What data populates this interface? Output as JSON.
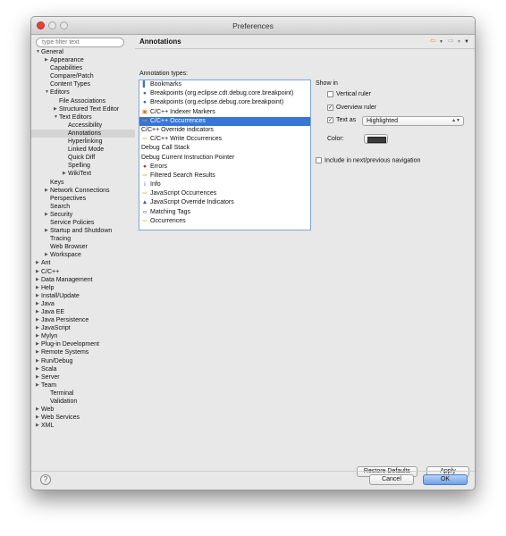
{
  "window": {
    "title": "Preferences"
  },
  "filter": {
    "placeholder": "type filter text"
  },
  "tree": [
    {
      "label": "General",
      "level": 0,
      "tw": "down"
    },
    {
      "label": "Appearance",
      "level": 1,
      "tw": "right"
    },
    {
      "label": "Capabilities",
      "level": 1
    },
    {
      "label": "Compare/Patch",
      "level": 1
    },
    {
      "label": "Content Types",
      "level": 1
    },
    {
      "label": "Editors",
      "level": 1,
      "tw": "down"
    },
    {
      "label": "File Associations",
      "level": 2
    },
    {
      "label": "Structured Text Editor",
      "level": 2,
      "tw": "right"
    },
    {
      "label": "Text Editors",
      "level": 2,
      "tw": "down"
    },
    {
      "label": "Accessibility",
      "level": 3
    },
    {
      "label": "Annotations",
      "level": 3,
      "selected": true
    },
    {
      "label": "Hyperlinking",
      "level": 3
    },
    {
      "label": "Linked Mode",
      "level": 3
    },
    {
      "label": "Quick Diff",
      "level": 3
    },
    {
      "label": "Spelling",
      "level": 3
    },
    {
      "label": "WikiText",
      "level": 3,
      "tw": "right"
    },
    {
      "label": "Keys",
      "level": 1
    },
    {
      "label": "Network Connections",
      "level": 1,
      "tw": "right"
    },
    {
      "label": "Perspectives",
      "level": 1
    },
    {
      "label": "Search",
      "level": 1
    },
    {
      "label": "Security",
      "level": 1,
      "tw": "right"
    },
    {
      "label": "Service Policies",
      "level": 1
    },
    {
      "label": "Startup and Shutdown",
      "level": 1,
      "tw": "right"
    },
    {
      "label": "Tracing",
      "level": 1
    },
    {
      "label": "Web Browser",
      "level": 1
    },
    {
      "label": "Workspace",
      "level": 1,
      "tw": "right"
    },
    {
      "label": "Ant",
      "level": 0,
      "tw": "right"
    },
    {
      "label": "C/C++",
      "level": 0,
      "tw": "right"
    },
    {
      "label": "Data Management",
      "level": 0,
      "tw": "right"
    },
    {
      "label": "Help",
      "level": 0,
      "tw": "right"
    },
    {
      "label": "Install/Update",
      "level": 0,
      "tw": "right"
    },
    {
      "label": "Java",
      "level": 0,
      "tw": "right"
    },
    {
      "label": "Java EE",
      "level": 0,
      "tw": "right"
    },
    {
      "label": "Java Persistence",
      "level": 0,
      "tw": "right"
    },
    {
      "label": "JavaScript",
      "level": 0,
      "tw": "right"
    },
    {
      "label": "Mylyn",
      "level": 0,
      "tw": "right"
    },
    {
      "label": "Plug-in Development",
      "level": 0,
      "tw": "right"
    },
    {
      "label": "Remote Systems",
      "level": 0,
      "tw": "right"
    },
    {
      "label": "Run/Debug",
      "level": 0,
      "tw": "right"
    },
    {
      "label": "Scala",
      "level": 0,
      "tw": "right"
    },
    {
      "label": "Server",
      "level": 0,
      "tw": "right"
    },
    {
      "label": "Team",
      "level": 0,
      "tw": "right"
    },
    {
      "label": "Terminal",
      "level": 1
    },
    {
      "label": "Validation",
      "level": 1
    },
    {
      "label": "Web",
      "level": 0,
      "tw": "right"
    },
    {
      "label": "Web Services",
      "level": 0,
      "tw": "right"
    },
    {
      "label": "XML",
      "level": 0,
      "tw": "right"
    }
  ],
  "page": {
    "title": "Annotations",
    "annotation_types_label": "Annotation types:",
    "annotation_types": [
      {
        "label": "Bookmarks",
        "icon": "bookmark-icon",
        "glyph": "▌",
        "color": "#3a6fc9"
      },
      {
        "label": "Breakpoints (org.eclipse.cdt.debug.core.breakpoint)",
        "icon": "breakpoint-icon",
        "glyph": "●",
        "color": "#3b6bb0"
      },
      {
        "label": "Breakpoints (org.eclipse.debug.core.breakpoint)",
        "icon": "breakpoint-icon",
        "glyph": "●",
        "color": "#3b6bb0"
      },
      {
        "label": "C/C++ Indexer Markers",
        "icon": "indexer-marker-icon",
        "glyph": "▣",
        "color": "#c77a1e"
      },
      {
        "label": "C/C++ Occurrences",
        "icon": "occurrence-arrow-icon",
        "glyph": "⇨",
        "color": "#e6a21e",
        "selected": true
      },
      {
        "label": "C/C++ Override indicators",
        "icon": "",
        "glyph": "",
        "color": ""
      },
      {
        "label": "C/C++ Write Occurrences",
        "icon": "occurrence-arrow-icon",
        "glyph": "⇨",
        "color": "#e6a21e"
      },
      {
        "label": "Debug Call Stack",
        "icon": "",
        "glyph": "",
        "color": ""
      },
      {
        "label": "Debug Current Instruction Pointer",
        "icon": "",
        "glyph": "",
        "color": ""
      },
      {
        "label": "Errors",
        "icon": "error-icon",
        "glyph": "●",
        "color": "#d9261c"
      },
      {
        "label": "Filtered Search Results",
        "icon": "search-result-arrow-icon",
        "glyph": "⇨",
        "color": "#e6a21e"
      },
      {
        "label": "Info",
        "icon": "info-icon",
        "glyph": "i",
        "color": "#2a4f9c"
      },
      {
        "label": "JavaScript Occurrences",
        "icon": "occurrence-arrow-icon",
        "glyph": "⇨",
        "color": "#e6a21e"
      },
      {
        "label": "JavaScript Override Indicators",
        "icon": "override-indicator-icon",
        "glyph": "▲",
        "color": "#2b5fa8"
      },
      {
        "label": "Matching Tags",
        "icon": "matching-tags-icon",
        "glyph": "‹›",
        "color": "#333333"
      },
      {
        "label": "Occurrences",
        "icon": "occurrence-arrow-icon",
        "glyph": "⇨",
        "color": "#e6a21e"
      }
    ],
    "show_in_label": "Show in",
    "vertical_ruler": {
      "label": "Vertical ruler",
      "checked": false
    },
    "overview_ruler": {
      "label": "Overview ruler",
      "checked": true
    },
    "text_as": {
      "label": "Text as",
      "checked": true,
      "value": "Highlighted"
    },
    "color_label": "Color:",
    "color_value": "#3b3b3b",
    "include_nav": {
      "label": "Include in next/previous navigation",
      "checked": false
    },
    "restore_defaults_label": "Restore Defaults",
    "apply_label": "Apply"
  },
  "footer": {
    "cancel_label": "Cancel",
    "ok_label": "OK",
    "help_glyph": "?"
  },
  "colors": {
    "selection": "#3875d7",
    "list_border": "#7fa5cf"
  }
}
